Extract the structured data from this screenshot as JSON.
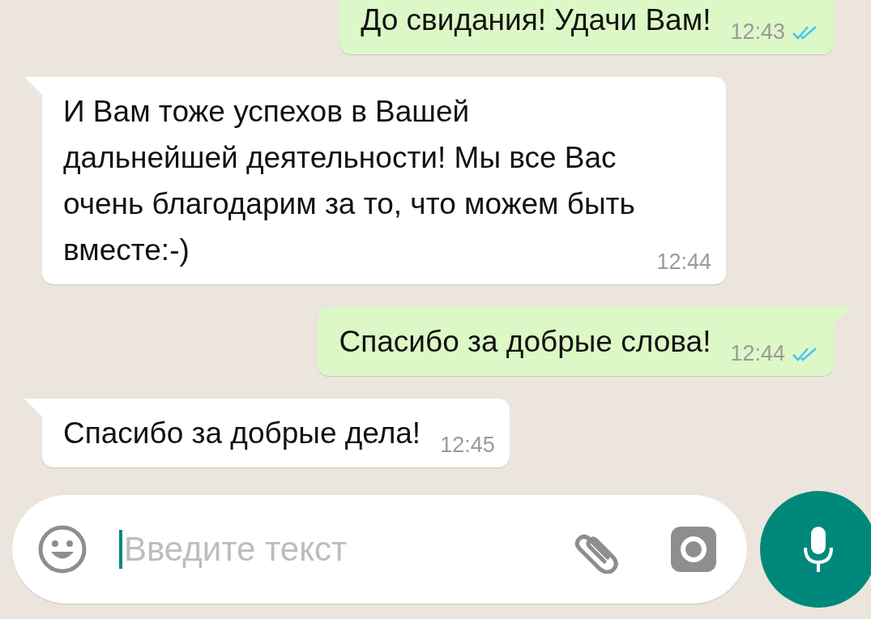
{
  "messages": [
    {
      "kind": "outgoing",
      "text": "До свидания! Удачи Вам!",
      "time": "12:43",
      "read": true,
      "tail": false
    },
    {
      "kind": "incoming",
      "text": "И Вам тоже успехов в Вашей дальнейшей деятельности! Мы все Вас очень благодарим за то, что можем быть вместе:-)",
      "time": "12:44",
      "tail": true
    },
    {
      "kind": "outgoing",
      "text": "Спасибо за добрые слова!",
      "time": "12:44",
      "read": true,
      "tail": true
    },
    {
      "kind": "incoming",
      "text": "Спасибо за добрые дела!",
      "time": "12:45",
      "tail": true
    }
  ],
  "composer": {
    "placeholder": "Введите текст"
  }
}
